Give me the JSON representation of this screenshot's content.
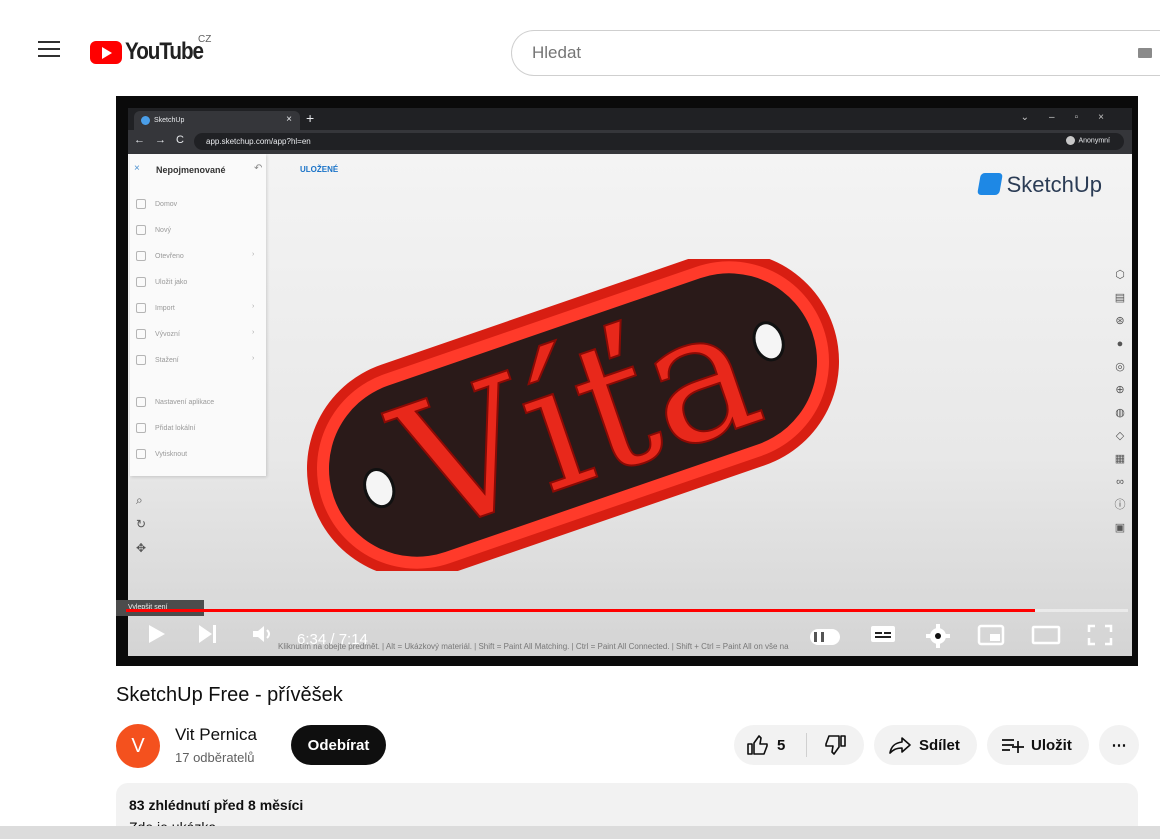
{
  "header": {
    "logo_text": "YouTube",
    "country_code": "CZ",
    "search_placeholder": "Hledat"
  },
  "video": {
    "browser": {
      "tab_title": "SketchUp",
      "url": "app.sketchup.com/app?hl=en",
      "profile_label": "Anonymní"
    },
    "sketchup": {
      "model_title": "Nepojmenované",
      "saved_label": "ULOŽENÉ",
      "brand": "SketchUp",
      "menu_items": [
        {
          "label": "Domov",
          "has_arrow": false
        },
        {
          "label": "Nový",
          "has_arrow": false
        },
        {
          "label": "Otevřeno",
          "has_arrow": true
        },
        {
          "label": "Uložit jako",
          "has_arrow": false
        },
        {
          "label": "Import",
          "has_arrow": true
        },
        {
          "label": "Vývozní",
          "has_arrow": true
        },
        {
          "label": "Stažení",
          "has_arrow": true
        },
        {
          "label": "Nastavení aplikace",
          "has_arrow": false
        },
        {
          "label": "Přidat lokální",
          "has_arrow": false
        },
        {
          "label": "Vytisknout",
          "has_arrow": false
        }
      ],
      "model_text": "Víťa",
      "status_text": "Kliknutím na obejte předmět. | Alt = Ukázkový materiál. | Shift = Paint All Matching. | Ctrl = Paint All Connected. | Shift + Ctrl = Paint All on vše na",
      "tooltip": "Vylepšit sení"
    },
    "player": {
      "time_display": "6:34 / 7:14",
      "progress_fraction": 0.907
    }
  },
  "title": "SketchUp Free - přívěšek",
  "channel": {
    "avatar_letter": "V",
    "name": "Vit Pernica",
    "subscribers": "17 odběratelů",
    "subscribe_label": "Odebírat"
  },
  "actions": {
    "likes": "5",
    "share_label": "Sdílet",
    "save_label": "Uložit",
    "more_label": "⋯"
  },
  "description": {
    "stats": "83 zhlédnutí  před 8 měsíci",
    "preview": "Zde je ukázka"
  },
  "colors": {
    "youtube_red": "#ff0000",
    "avatar_orange": "#f4511e",
    "model_red": "#e8281b",
    "model_dark": "#2a1a19"
  }
}
